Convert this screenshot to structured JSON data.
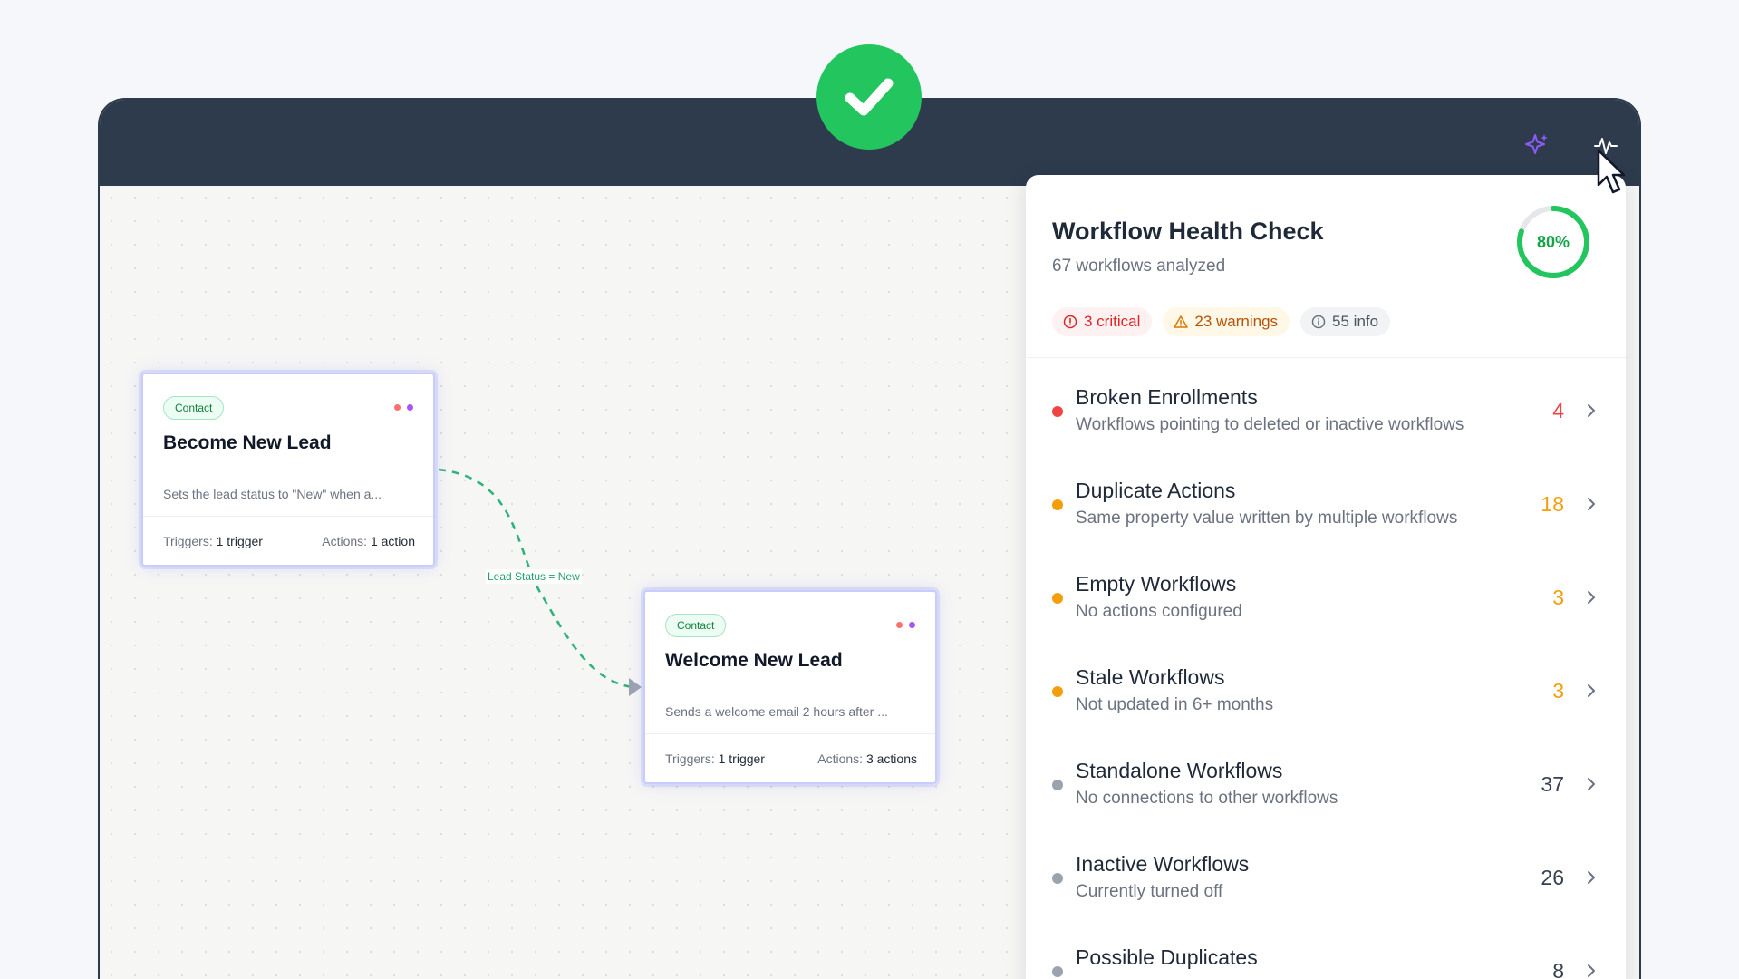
{
  "colors": {
    "topbar": "#2d3b4d",
    "success": "#22c55e",
    "critical": "#ef4444",
    "warning": "#f59e0b",
    "muted": "#9ca3af",
    "edge": "#2bb37a",
    "accent_purple": "#8b5cf6"
  },
  "icons": {
    "success": "checkmark-icon",
    "ai": "sparkle-icon",
    "health": "pulse-icon",
    "critical": "alert-circle-icon",
    "warning": "alert-triangle-icon",
    "info": "info-circle-icon",
    "row": "chevron-right-icon",
    "pointer": "mouse-cursor-icon"
  },
  "canvas": {
    "cards": [
      {
        "badge": "Contact",
        "title": "Become New Lead",
        "description": "Sets the lead status to \"New\" when a...",
        "triggers_label": "Triggers:",
        "triggers_value": "1 trigger",
        "actions_label": "Actions:",
        "actions_value": "1 action"
      },
      {
        "badge": "Contact",
        "title": "Welcome New Lead",
        "description": "Sends a welcome email 2 hours after ...",
        "triggers_label": "Triggers:",
        "triggers_value": "1 trigger",
        "actions_label": "Actions:",
        "actions_value": "3 actions"
      }
    ],
    "edge_label": "Lead Status = New"
  },
  "panel": {
    "title": "Workflow Health Check",
    "subtitle": "67 workflows analyzed",
    "score_label": "80%",
    "score_fraction": 0.8,
    "pills": {
      "critical": "3 critical",
      "warnings": "23 warnings",
      "info": "55 info"
    },
    "issues": [
      {
        "title": "Broken Enrollments",
        "description": "Workflows pointing to deleted or inactive workflows",
        "count": "4",
        "severity": "critical"
      },
      {
        "title": "Duplicate Actions",
        "description": "Same property value written by multiple workflows",
        "count": "18",
        "severity": "warning"
      },
      {
        "title": "Empty Workflows",
        "description": "No actions configured",
        "count": "3",
        "severity": "warning"
      },
      {
        "title": "Stale Workflows",
        "description": "Not updated in 6+ months",
        "count": "3",
        "severity": "warning"
      },
      {
        "title": "Standalone Workflows",
        "description": "No connections to other workflows",
        "count": "37",
        "severity": "info"
      },
      {
        "title": "Inactive Workflows",
        "description": "Currently turned off",
        "count": "26",
        "severity": "info"
      },
      {
        "title": "Possible Duplicates",
        "description": "",
        "count": "8",
        "severity": "info"
      }
    ]
  }
}
